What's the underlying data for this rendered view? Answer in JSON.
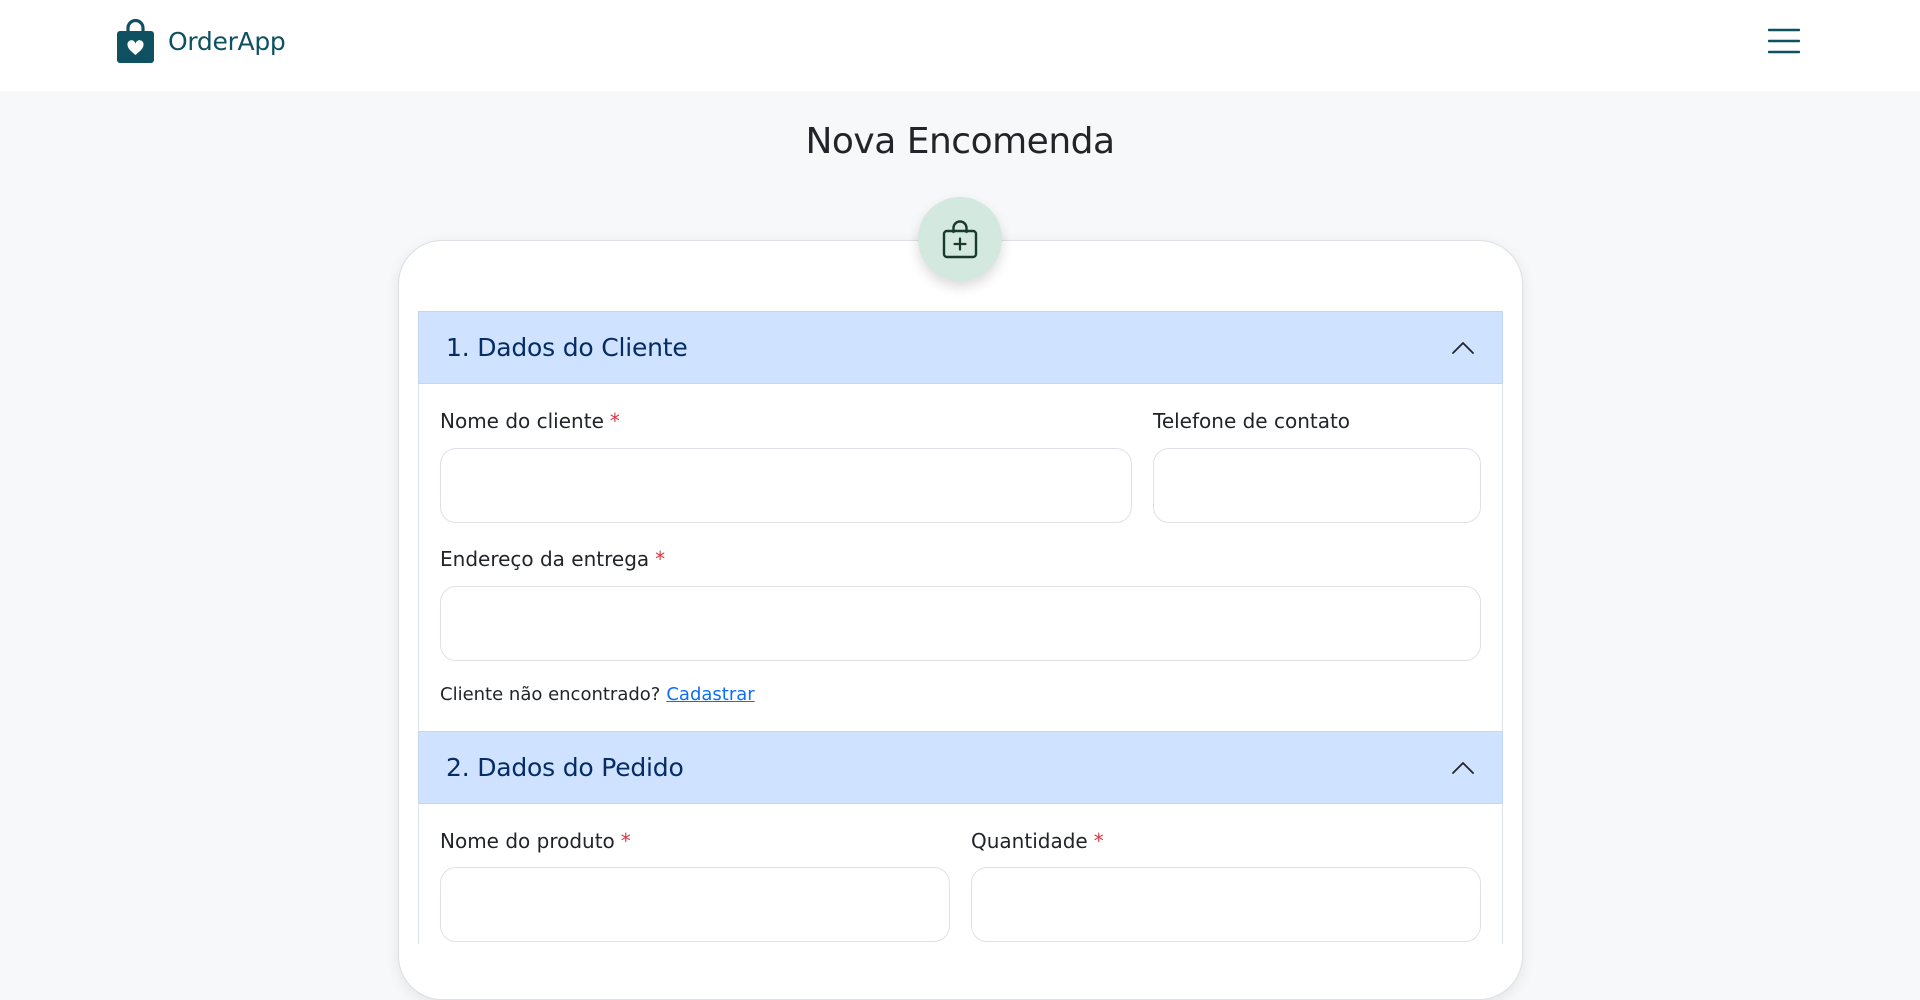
{
  "app": {
    "brand_name": "OrderApp",
    "brand_color": "#0f5161"
  },
  "icons": {
    "brand": "shopping-bag-heart-icon",
    "menu": "hamburger-menu-icon",
    "badge": "shopping-bag-plus-icon",
    "collapse": "chevron-up-icon"
  },
  "page": {
    "title": "Nova Encomenda"
  },
  "section1": {
    "title": "1. Dados do Cliente",
    "fields": {
      "customer_name": {
        "label": "Nome do cliente",
        "required_mark": "*",
        "value": ""
      },
      "phone": {
        "label": "Telefone de contato",
        "value": ""
      },
      "address": {
        "label": "Endereço da entrega",
        "required_mark": "*",
        "value": ""
      }
    },
    "helper_text": "Cliente não encontrado?",
    "helper_link": "Cadastrar"
  },
  "section2": {
    "title": "2. Dados do Pedido",
    "fields": {
      "product_name": {
        "label": "Nome do produto",
        "required_mark": "*",
        "value": ""
      },
      "quantity": {
        "label": "Quantidade",
        "required_mark": "*",
        "value": ""
      }
    }
  },
  "colors": {
    "section_header_bg": "#cfe2ff",
    "section_header_text": "#052c65",
    "required": "#dc3545",
    "link": "#0d6efd",
    "badge_bg": "#d3e8df"
  }
}
